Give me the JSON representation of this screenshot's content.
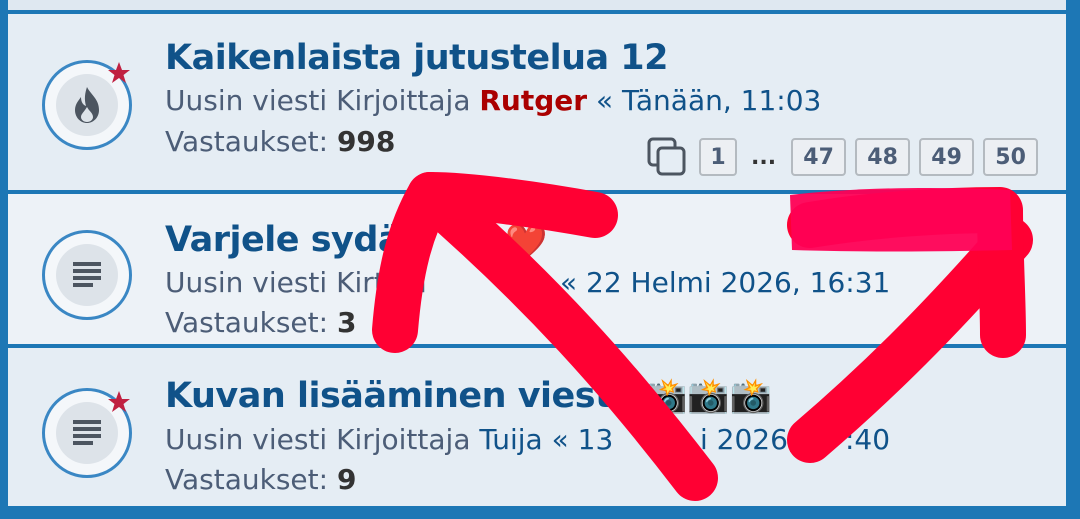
{
  "topics": [
    {
      "title": "Kaikenlaista jutustelua 12",
      "meta_prefix": "Uusin viesti Kirjoittaja ",
      "author": "Rutger",
      "date": " « Tänään, 11:03",
      "replies_label": "Vastaukset: ",
      "replies_count": "998",
      "icon": "hot-topic-flame-icon",
      "pages": [
        "1",
        "...",
        "47",
        "48",
        "49",
        "50"
      ]
    },
    {
      "title": "Varjele sydä",
      "meta_prefix": "Uusin viesti Kir",
      "author": "",
      "meta_suffix": "taja",
      "date": " « 22 Helmi 2026, 16:31",
      "replies_label": "Vastaukset: ",
      "replies_count": "3",
      "icon": "topic-document-icon",
      "emoji": "❤️"
    },
    {
      "title": "Kuvan lisääminen viest",
      "emoji": "📸📸📸",
      "meta_prefix": "Uusin viesti Kirjoittaja ",
      "author": "Tuija",
      "date": " « 13 ",
      "date_tail": "i 2026, ",
      "date_tail2": ":40",
      "replies_label": "Vastaukset: ",
      "replies_count": "9",
      "icon": "topic-document-icon"
    }
  ],
  "colors": {
    "link": "#105289",
    "author_red": "#aa0000",
    "border": "#1d77b5",
    "annotation": "#ff0033"
  }
}
